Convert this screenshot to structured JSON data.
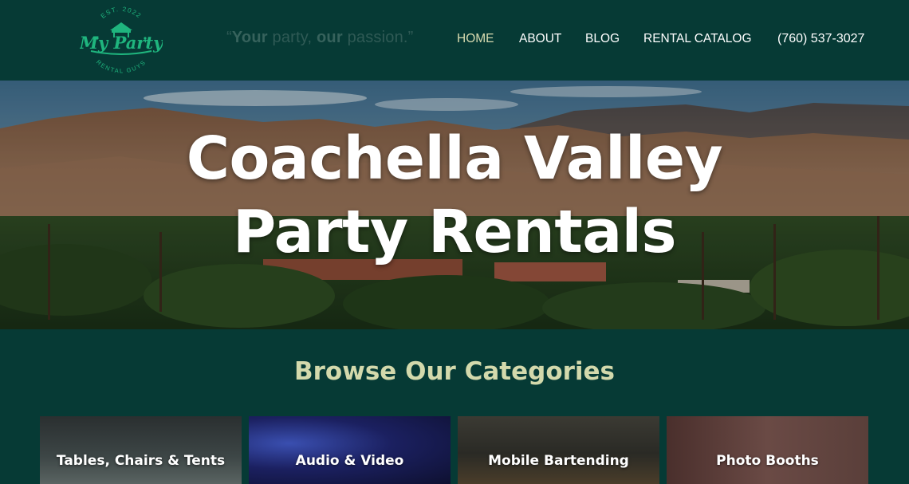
{
  "logo": {
    "est_text": "EST. 2022",
    "brand_text": "My Party",
    "sub_text": "RENTAL GUYS"
  },
  "header": {
    "tagline_open": "“",
    "tagline_w1": "Your",
    "tagline_w2": " party, ",
    "tagline_w3": "our",
    "tagline_w4": " passion.”",
    "nav": [
      "HOME",
      "ABOUT",
      "BLOG",
      "RENTAL CATALOG"
    ],
    "active_nav": "HOME",
    "phone": "(760) 537-3027"
  },
  "hero": {
    "title_line1": "Coachella Valley",
    "title_line2": "Party Rentals"
  },
  "browse": {
    "title": "Browse Our Categories",
    "cards": [
      {
        "label": "Tables, Chairs & Tents"
      },
      {
        "label": "Audio & Video"
      },
      {
        "label": "Mobile Bartending"
      },
      {
        "label": "Photo Booths"
      }
    ]
  },
  "colors": {
    "background": "#063a35",
    "nav_active": "#d8dbb0",
    "logo_green": "#1fb57e",
    "browse_title": "#d3d9ac"
  }
}
